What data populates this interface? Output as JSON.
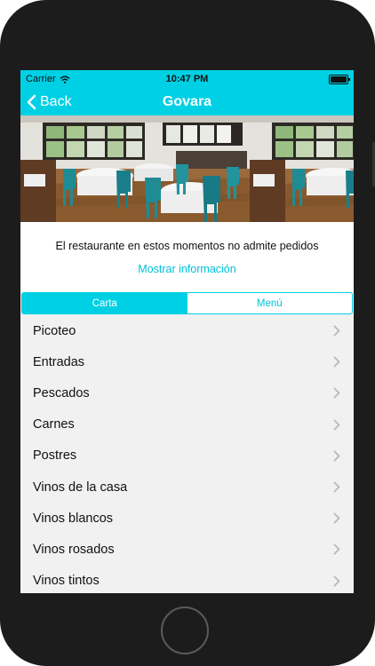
{
  "status_bar": {
    "carrier": "Carrier",
    "time": "10:47 PM"
  },
  "nav": {
    "back_label": "Back",
    "title": "Govara"
  },
  "info": {
    "message": "El restaurante en estos momentos no admite pedidos",
    "link": "Mostrar información"
  },
  "tabs": [
    {
      "label": "Carta",
      "active": true
    },
    {
      "label": "Menú",
      "active": false
    }
  ],
  "categories": [
    "Picoteo",
    "Entradas",
    "Pescados",
    "Carnes",
    "Postres",
    "Vinos de la casa",
    "Vinos blancos",
    "Vinos rosados",
    "Vinos tintos"
  ],
  "colors": {
    "accent": "#00d0e4",
    "list_background": "#f1f1f1",
    "phone_frame": "#1c1c1c"
  },
  "icons": [
    "wifi-icon",
    "battery-icon",
    "chevron-left-icon",
    "chevron-right-icon"
  ]
}
